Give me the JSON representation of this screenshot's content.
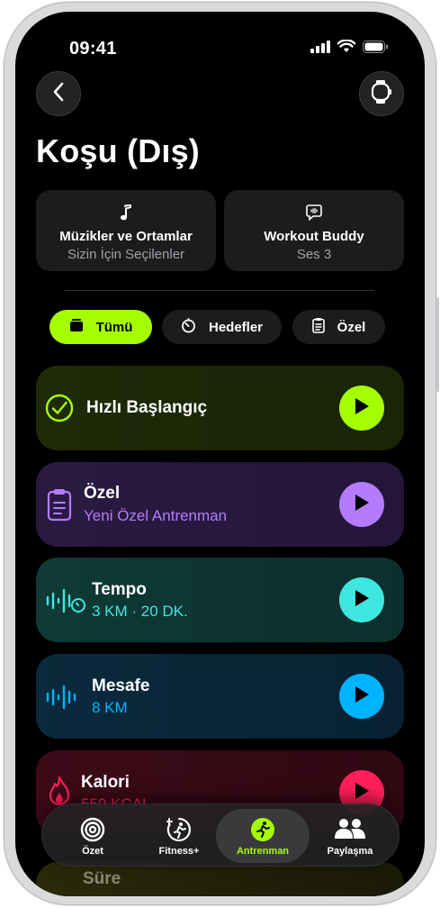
{
  "status": {
    "time": "09:41"
  },
  "header": {
    "title": "Koşu (Dış)"
  },
  "cards": [
    {
      "title": "Müzikler ve Ortamlar",
      "subtitle": "Sizin İçin Seçilenler",
      "icon": "music-note-icon"
    },
    {
      "title": "Workout Buddy",
      "subtitle": "Ses 3",
      "icon": "speech-bubble-waveform-icon"
    }
  ],
  "filters": [
    {
      "label": "Tümü",
      "icon": "stack-icon",
      "active": true
    },
    {
      "label": "Hedefler",
      "icon": "timer-icon",
      "active": false
    },
    {
      "label": "Özel",
      "icon": "clipboard-icon",
      "active": false
    }
  ],
  "workouts": [
    {
      "title": "Hızlı Başlangıç",
      "subtitle": "",
      "icon": "checkmark-circle-icon",
      "accent": "#a6ff00"
    },
    {
      "title": "Özel",
      "subtitle": "Yeni Özel Antrenman",
      "icon": "clipboard-icon",
      "accent": "#b57bff"
    },
    {
      "title": "Tempo",
      "subtitle": "3 KM · 20 DK.",
      "icon": "tempo-pace-icon",
      "accent": "#3ee8e0"
    },
    {
      "title": "Mesafe",
      "subtitle": "8 KM",
      "icon": "distance-waveform-icon",
      "accent": "#00b3ff"
    },
    {
      "title": "Kalori",
      "subtitle": "550 KCAL",
      "icon": "flame-icon",
      "accent": "#ff1f5a"
    },
    {
      "title": "Süre",
      "subtitle": "",
      "icon": "timer-icon",
      "accent": "#d6ff3d"
    }
  ],
  "tabbar": [
    {
      "label": "Özet",
      "icon": "activity-rings-icon",
      "active": false
    },
    {
      "label": "Fitness+",
      "icon": "fitness-plus-icon",
      "active": false
    },
    {
      "label": "Antrenman",
      "icon": "running-figure-icon",
      "active": true
    },
    {
      "label": "Paylaşma",
      "icon": "people-icon",
      "active": false
    }
  ],
  "colors": {
    "accent": "#a6ff00",
    "background": "#000000",
    "card": "#1c1c1e"
  }
}
